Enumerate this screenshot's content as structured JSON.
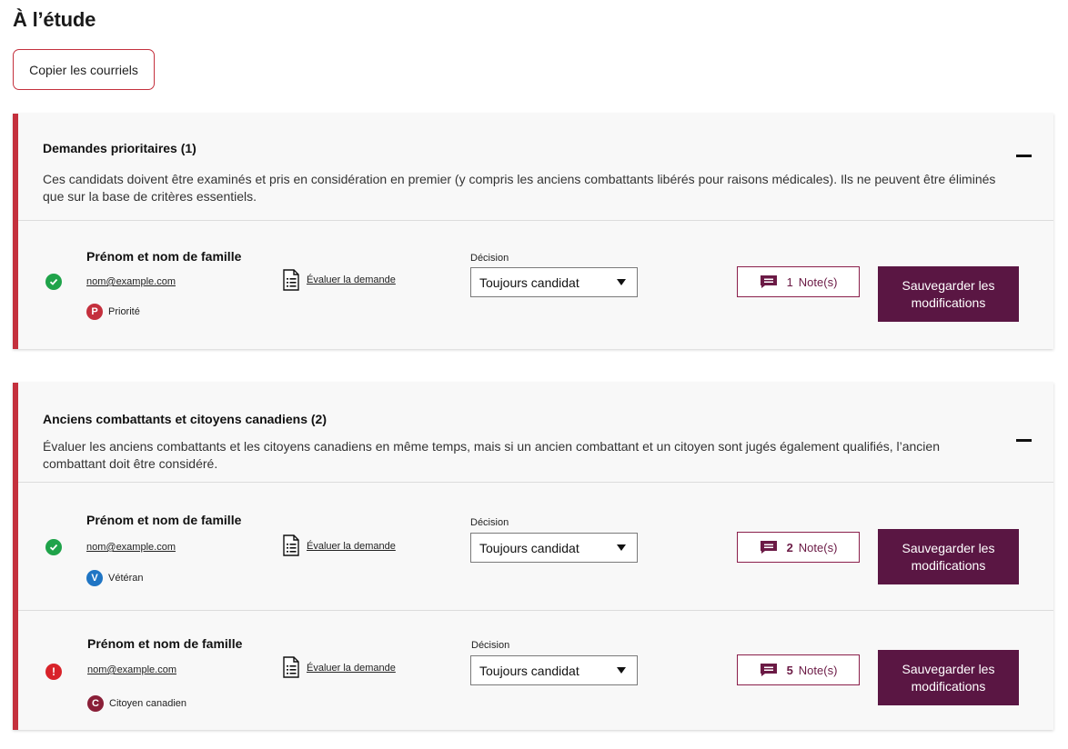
{
  "page": {
    "title": "À l’étude"
  },
  "toolbar": {
    "copy_label": "Copier les courriels"
  },
  "sections": [
    {
      "title": "Demandes prioritaires (1)",
      "description": "Ces candidats doivent être examinés et pris en considération en premier (y compris les anciens combattants libérés pour raisons médicales). Ils ne peuvent être éliminés que sur la base de critères essentiels.",
      "rows": [
        {
          "status": "ok",
          "name": "Prénom et nom de famille",
          "email": "nom@example.com",
          "badge_letter": "P",
          "badge_label": "Priorité",
          "badge_color": "#c4303d",
          "eval_label": "Évaluer la demande",
          "decision_label": "Décision",
          "decision_value": "Toujours candidat",
          "notes_count": "1",
          "notes_label": "Note(s)",
          "save_label": "Sauvegarder les modifications"
        }
      ]
    },
    {
      "title": "Anciens combattants et citoyens canadiens (2)",
      "description": "Évaluer les anciens combattants et les citoyens canadiens en même temps, mais si un ancien combattant et un citoyen sont jugés également qualifiés, l’ancien combattant doit être considéré.",
      "rows": [
        {
          "status": "ok",
          "name": "Prénom et nom de famille",
          "email": "nom@example.com",
          "badge_letter": "V",
          "badge_label": "Vétéran",
          "badge_color": "#1f75c4",
          "eval_label": "Évaluer la demande",
          "decision_label": "Décision",
          "decision_value": "Toujours candidat",
          "notes_count": "2",
          "notes_label": "Note(s)",
          "save_label": "Sauvegarder les modifications"
        },
        {
          "status": "warn",
          "status_glyph": "!",
          "name": "Prénom et nom de famille",
          "email": "nom@example.com",
          "badge_letter": "C",
          "badge_label": "Citoyen canadien",
          "badge_color": "#8a1f38",
          "eval_label": "Évaluer la demande",
          "decision_label": "Décision",
          "decision_value": "Toujours candidat",
          "notes_count": "5",
          "notes_label": "Note(s)",
          "save_label": "Sauvegarder les modifications"
        }
      ]
    }
  ],
  "colors": {
    "accent_red": "#c4303d",
    "primary_button": "#5a1643",
    "success": "#1fa34a",
    "warning": "#d8232a"
  },
  "icons": {
    "status_ok": "check-circle-icon",
    "status_warn": "exclamation-circle-icon",
    "document": "document-icon",
    "notes": "chat-bubble-icon",
    "collapse": "minus-icon",
    "dropdown": "caret-down-icon"
  }
}
